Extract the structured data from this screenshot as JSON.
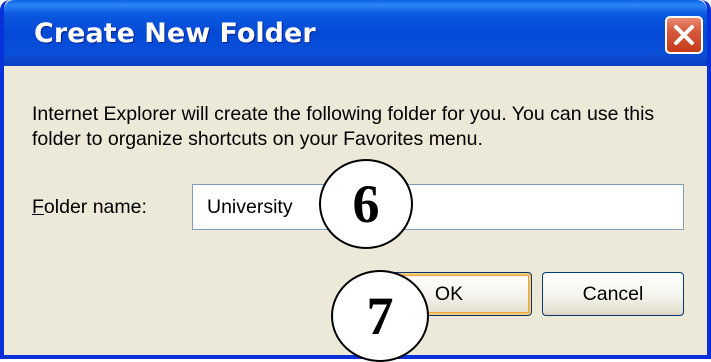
{
  "window": {
    "title": "Create New Folder"
  },
  "dialog": {
    "description": "Internet Explorer will create the following folder for you. You can use this folder to organize shortcuts on your Favorites menu.",
    "folder_label_mnemonic": "F",
    "folder_label_rest": "older name:",
    "folder_name_value": "University",
    "ok_label": "OK",
    "cancel_label": "Cancel"
  },
  "callouts": {
    "six": "6",
    "seven": "7"
  },
  "colors": {
    "titlebar": "#0449d6",
    "frame_border": "#0831d9",
    "dialog_bg": "#ece9d8",
    "close_button": "#c53a1d"
  },
  "icons": {
    "close": "close-icon"
  }
}
